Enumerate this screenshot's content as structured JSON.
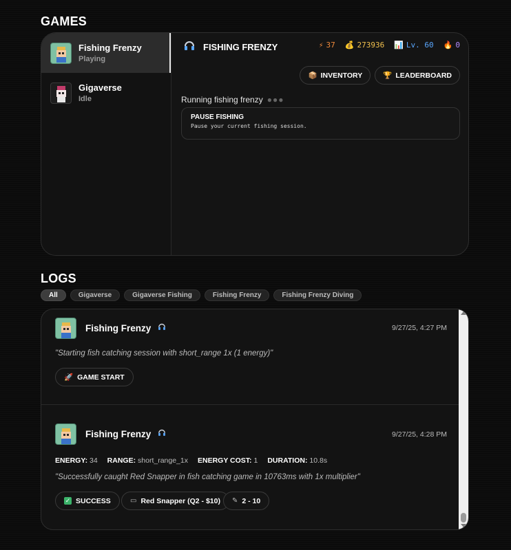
{
  "games_section": {
    "title": "GAMES"
  },
  "games": [
    {
      "name": "Fishing Frenzy",
      "status": "Playing"
    },
    {
      "name": "Gigaverse",
      "status": "Idle"
    }
  ],
  "detail": {
    "title": "FISHING FRENZY",
    "stats": {
      "energy": "37",
      "gold": "273936",
      "level": "Lv. 60",
      "streak": "0"
    },
    "buttons": {
      "inventory": "INVENTORY",
      "leaderboard": "LEADERBOARD"
    },
    "running_text": "Running fishing frenzy",
    "action": {
      "title": "PAUSE FISHING",
      "desc": "Pause your current fishing session."
    }
  },
  "logs_section": {
    "title": "LOGS"
  },
  "filters": [
    "All",
    "Gigaverse",
    "Gigaverse Fishing",
    "Fishing Frenzy",
    "Fishing Frenzy Diving"
  ],
  "logs": [
    {
      "game": "Fishing Frenzy",
      "time": "9/27/25, 4:27 PM",
      "message": "\"Starting fish catching session with short_range 1x (1 energy)\"",
      "tag": "GAME START"
    },
    {
      "game": "Fishing Frenzy",
      "time": "9/27/25, 4:28 PM",
      "kv": {
        "energy_label": "ENERGY:",
        "energy": "34",
        "range_label": "RANGE:",
        "range": "short_range_1x",
        "cost_label": "ENERGY COST:",
        "cost": "1",
        "duration_label": "DURATION:",
        "duration": "10.8s"
      },
      "message": "\"Successfully caught Red Snapper in fish catching game in 10763ms with 1x multiplier\"",
      "tags": [
        "SUCCESS",
        "Red Snapper (Q2 - $10)",
        "2 - 10"
      ]
    }
  ],
  "colors": {
    "energy": "#f08a3c",
    "gold": "#f2c14e",
    "level": "#5aa8ff",
    "streak": "#b28cff"
  }
}
